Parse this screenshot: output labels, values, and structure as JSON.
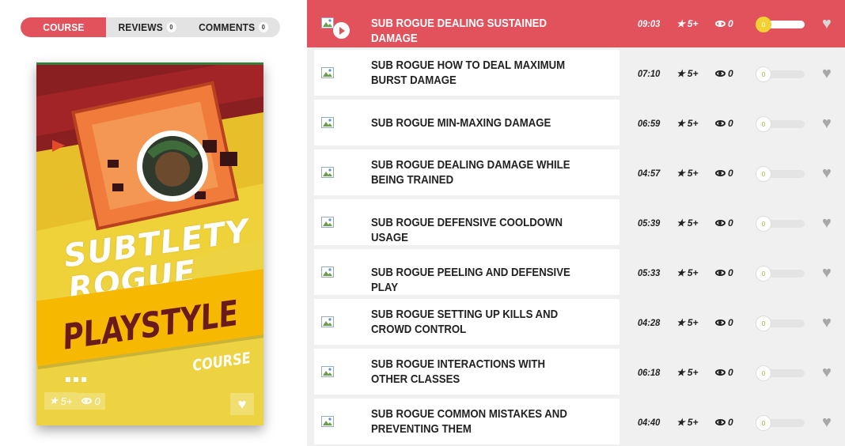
{
  "tabs": [
    {
      "label": "COURSE",
      "count": null,
      "active": true
    },
    {
      "label": "REVIEWS",
      "count": "0",
      "active": false
    },
    {
      "label": "COMMENTS",
      "count": "0",
      "active": false
    }
  ],
  "cover": {
    "line1a": "SUBTLETY",
    "line1b": "ROGUE",
    "line2": "PLAYSTYLE",
    "line3": "COURSE",
    "rating": "5+",
    "views": "0"
  },
  "colors": {
    "accent": "#e2525c",
    "yellow": "#f2d233"
  },
  "lessons": [
    {
      "title": "SUB ROGUE DEALING SUSTAINED DAMAGE",
      "duration": "09:03",
      "rating": "5+",
      "views": "0",
      "progress": "0",
      "active": true
    },
    {
      "title": "SUB ROGUE HOW TO DEAL MAXIMUM BURST DAMAGE",
      "duration": "07:10",
      "rating": "5+",
      "views": "0",
      "progress": "0",
      "active": false
    },
    {
      "title": "SUB ROGUE MIN-MAXING DAMAGE",
      "duration": "06:59",
      "rating": "5+",
      "views": "0",
      "progress": "0",
      "active": false
    },
    {
      "title": "SUB ROGUE DEALING DAMAGE WHILE BEING TRAINED",
      "duration": "04:57",
      "rating": "5+",
      "views": "0",
      "progress": "0",
      "active": false
    },
    {
      "title": "SUB ROGUE DEFENSIVE COOLDOWN USAGE",
      "duration": "05:39",
      "rating": "5+",
      "views": "0",
      "progress": "0",
      "active": false
    },
    {
      "title": "SUB ROGUE PEELING AND DEFENSIVE PLAY",
      "duration": "05:33",
      "rating": "5+",
      "views": "0",
      "progress": "0",
      "active": false
    },
    {
      "title": "SUB ROGUE SETTING UP KILLS AND CROWD CONTROL",
      "duration": "04:28",
      "rating": "5+",
      "views": "0",
      "progress": "0",
      "active": false
    },
    {
      "title": "SUB ROGUE INTERACTIONS WITH OTHER CLASSES",
      "duration": "06:18",
      "rating": "5+",
      "views": "0",
      "progress": "0",
      "active": false
    },
    {
      "title": "SUB ROGUE COMMON MISTAKES AND PREVENTING THEM",
      "duration": "04:40",
      "rating": "5+",
      "views": "0",
      "progress": "0",
      "active": false
    }
  ]
}
